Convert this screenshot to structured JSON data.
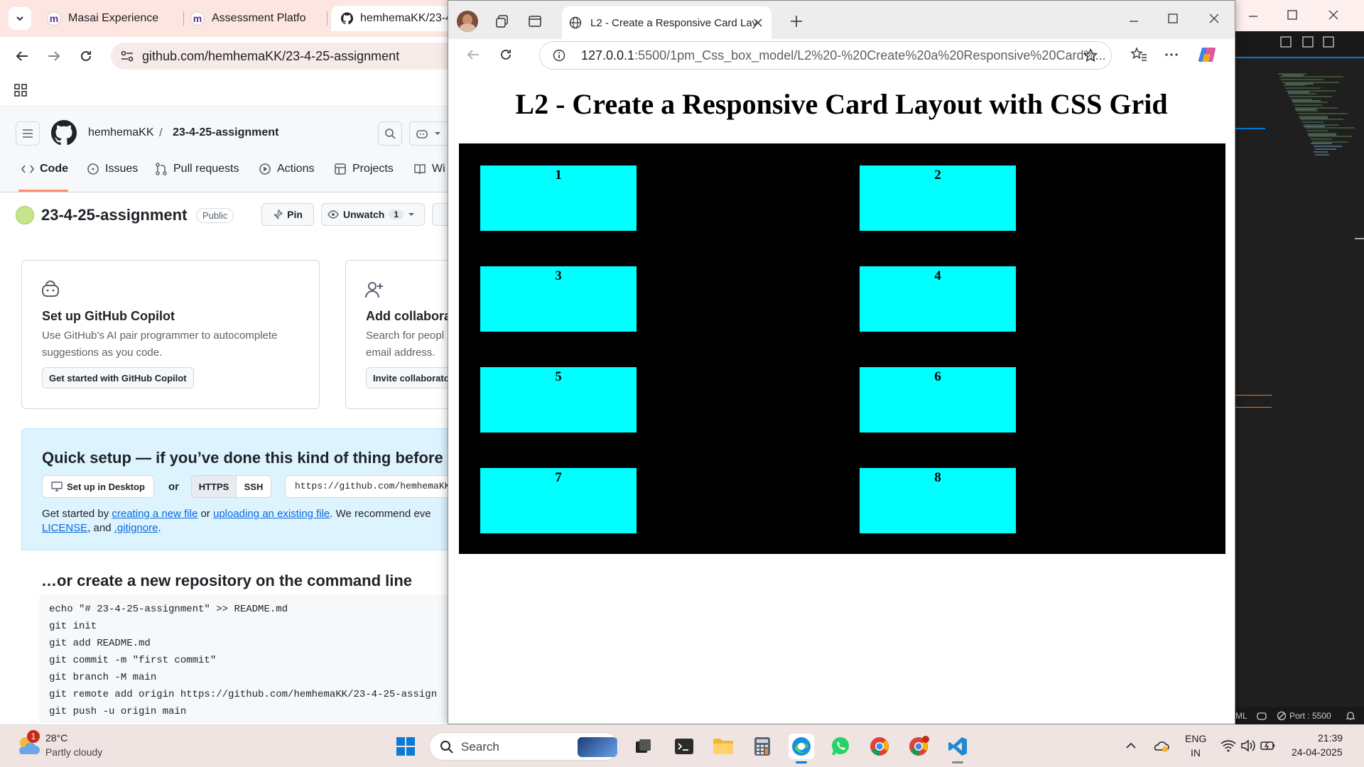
{
  "left_browser": {
    "tabs": [
      {
        "label": "Masai Experience"
      },
      {
        "label": "Assessment Platfo"
      },
      {
        "label": "hemhemaKK/23-4"
      }
    ],
    "url": "github.com/hemhemaKK/23-4-25-assignment",
    "github": {
      "owner": "hemhemaKK",
      "repo": "23-4-25-assignment",
      "nav": [
        "Code",
        "Issues",
        "Pull requests",
        "Actions",
        "Projects",
        "Wi"
      ],
      "repo_title": "23-4-25-assignment",
      "visibility": "Public",
      "pin_label": "Pin",
      "unwatch_label": "Unwatch",
      "watch_count": "1",
      "copilot_card": {
        "title": "Set up GitHub Copilot",
        "desc": "Use GitHub's AI pair programmer to autocomplete suggestions as you code.",
        "button": "Get started with GitHub Copilot"
      },
      "collab_card": {
        "title": "Add collabora",
        "desc": "Search for peopl email address.",
        "button": "Invite collaborato"
      },
      "quick_setup": {
        "title": "Quick setup — if you’ve done this kind of thing before",
        "desktop_button": "Set up in Desktop",
        "or": "or",
        "https": "HTTPS",
        "ssh": "SSH",
        "clone_url": "https://github.com/hemhemaKK/",
        "text_1": "Get started by",
        "link_1": "creating a new file",
        "text_2": "or",
        "link_2": "uploading an existing file",
        "text_3": ". We recommend eve",
        "link_3": "LICENSE",
        "text_4": ", and",
        "link_4": ".gitignore",
        "text_5": "."
      },
      "cmdline_title": "…or create a new repository on the command line",
      "commands": [
        "echo \"# 23-4-25-assignment\" >> README.md",
        "git init",
        "git add README.md",
        "git commit -m \"first commit\"",
        "git branch -M main",
        "git remote add origin https://github.com/hemhemaKK/23-4-25-assign",
        "git push -u origin main"
      ]
    }
  },
  "right_browser": {
    "tab_label": "L2 - Create a Responsive Card Lay",
    "url_host": "127.0.0.1",
    "url_rest": ":5500/1pm_Css_box_model/L2%20-%20Create%20a%20Responsive%20Card%...",
    "page_title": "L2 - Create a Responsive Card Layout with CSS Grid",
    "cards": [
      "1",
      "2",
      "3",
      "4",
      "5",
      "6",
      "7",
      "8"
    ],
    "colors": {
      "grid_bg": "#000000",
      "card_bg": "#00ffff"
    }
  },
  "vscode_status": {
    "left": "ML",
    "port": "Port : 5500"
  },
  "taskbar": {
    "weather_temp": "28°C",
    "weather_desc": "Partly cloudy",
    "weather_badge": "1",
    "search_label": "Search",
    "lang_1": "ENG",
    "lang_2": "IN",
    "time": "21:39",
    "date": "24-04-2025"
  }
}
